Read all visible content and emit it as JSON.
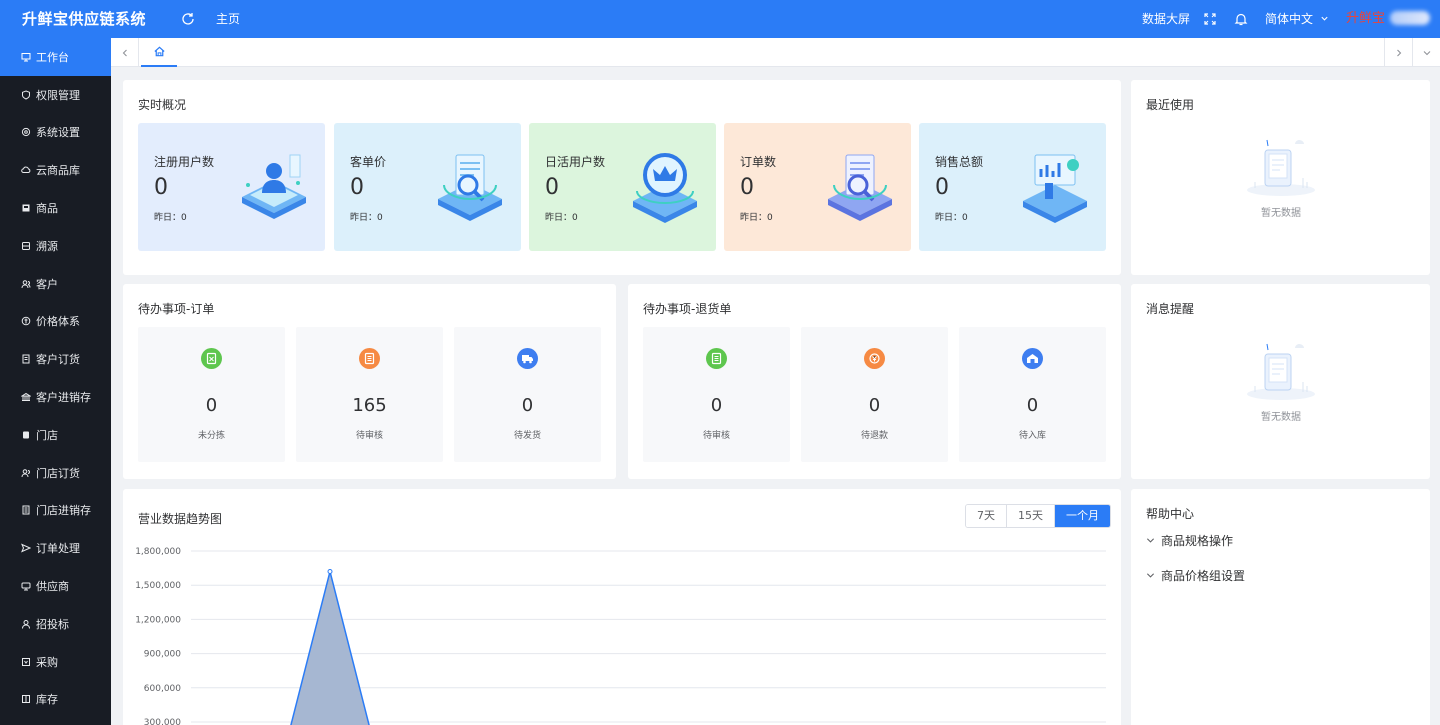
{
  "header": {
    "title": "升鲜宝供应链系统",
    "home": "主页",
    "data_screen": "数据大屏",
    "language": "简体中文",
    "user": "升鲜宝"
  },
  "sidebar": {
    "items": [
      {
        "label": "工作台",
        "icon": "monitor-icon"
      },
      {
        "label": "权限管理",
        "icon": "shield-icon"
      },
      {
        "label": "系统设置",
        "icon": "gear-icon"
      },
      {
        "label": "云商品库",
        "icon": "cloud-icon"
      },
      {
        "label": "商品",
        "icon": "goods-icon"
      },
      {
        "label": "溯源",
        "icon": "trace-icon"
      },
      {
        "label": "客户",
        "icon": "customer-icon"
      },
      {
        "label": "价格体系",
        "icon": "price-icon"
      },
      {
        "label": "客户订货",
        "icon": "order-icon"
      },
      {
        "label": "客户进销存",
        "icon": "bank-icon"
      },
      {
        "label": "门店",
        "icon": "store-icon"
      },
      {
        "label": "门店订货",
        "icon": "store-order-icon"
      },
      {
        "label": "门店进销存",
        "icon": "inventory-icon"
      },
      {
        "label": "订单处理",
        "icon": "send-icon"
      },
      {
        "label": "供应商",
        "icon": "supplier-icon"
      },
      {
        "label": "招投标",
        "icon": "bid-icon"
      },
      {
        "label": "采购",
        "icon": "purchase-icon"
      },
      {
        "label": "库存",
        "icon": "stock-icon"
      }
    ]
  },
  "overview": {
    "title": "实时概况",
    "yesterday_prefix": "昨日：",
    "stats": [
      {
        "label": "注册用户数",
        "value": "0",
        "yesterday": "0",
        "bg": "#e3edfd"
      },
      {
        "label": "客单价",
        "value": "0",
        "yesterday": "0",
        "bg": "#dcf0fb"
      },
      {
        "label": "日活用户数",
        "value": "0",
        "yesterday": "0",
        "bg": "#dcf5dd"
      },
      {
        "label": "订单数",
        "value": "0",
        "yesterday": "0",
        "bg": "#fde8d8"
      },
      {
        "label": "销售总额",
        "value": "0",
        "yesterday": "0",
        "bg": "#dcf0fb"
      }
    ]
  },
  "recent": {
    "title": "最近使用",
    "empty": "暂无数据"
  },
  "todo_order": {
    "title": "待办事项-订单",
    "items": [
      {
        "label": "未分拣",
        "value": "0",
        "color": "#5ec64e"
      },
      {
        "label": "待审核",
        "value": "165",
        "color": "#f68a43"
      },
      {
        "label": "待发货",
        "value": "0",
        "color": "#3e7ef0"
      }
    ]
  },
  "todo_return": {
    "title": "待办事项-退货单",
    "items": [
      {
        "label": "待审核",
        "value": "0",
        "color": "#5ec64e"
      },
      {
        "label": "待退款",
        "value": "0",
        "color": "#f68a43"
      },
      {
        "label": "待入库",
        "value": "0",
        "color": "#3e7ef0"
      }
    ]
  },
  "messages": {
    "title": "消息提醒",
    "empty": "暂无数据"
  },
  "trend": {
    "title": "营业数据趋势图",
    "ranges": [
      "7天",
      "15天",
      "一个月"
    ],
    "active_range": "一个月"
  },
  "help": {
    "title": "帮助中心",
    "items": [
      "商品规格操作",
      "商品价格组设置"
    ]
  },
  "chart_data": {
    "type": "area",
    "y_ticks": [
      "1,800,000",
      "1,500,000",
      "1,200,000",
      "900,000",
      "600,000",
      "300,000"
    ],
    "ylim": [
      0,
      1800000
    ],
    "x": [
      0,
      1,
      2
    ],
    "values": [
      0,
      1620000,
      0
    ],
    "color": "#2b7cf6",
    "fill": "#a6b7d2"
  }
}
